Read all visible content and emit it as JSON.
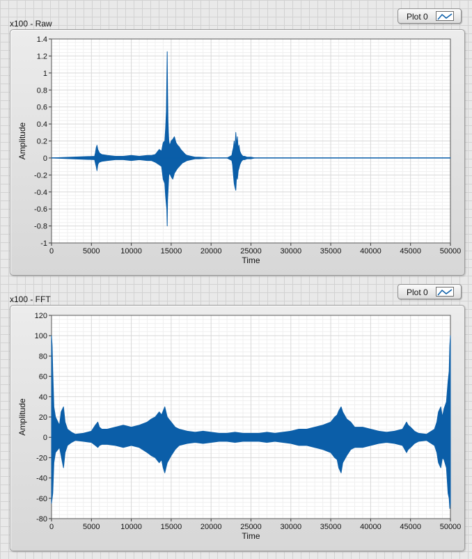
{
  "charts": [
    {
      "title": "x100 - Raw",
      "legend": "Plot 0"
    },
    {
      "title": "x100 - FFT",
      "legend": "Plot 0"
    }
  ],
  "chart_data": [
    {
      "type": "line",
      "title": "x100 - Raw",
      "xlabel": "Time",
      "ylabel": "Amplitude",
      "xlim": [
        0,
        50000
      ],
      "ylim": [
        -1,
        1.4
      ],
      "xticks": [
        0,
        5000,
        10000,
        15000,
        20000,
        25000,
        30000,
        35000,
        40000,
        45000,
        50000
      ],
      "yticks": [
        -1,
        -0.8,
        -0.6,
        -0.4,
        -0.2,
        0,
        0.2,
        0.4,
        0.6,
        0.8,
        1,
        1.2,
        1.4
      ],
      "grid": true,
      "legend_position": "top-right",
      "color": "#0b5ea8",
      "series": [
        {
          "name": "Plot 0",
          "x": [
            0,
            5400,
            5500,
            5600,
            5700,
            5800,
            5900,
            6000,
            6300,
            7000,
            8000,
            9000,
            10000,
            11000,
            12000,
            12500,
            13000,
            13500,
            13800,
            14000,
            14200,
            14300,
            14400,
            14450,
            14500,
            14550,
            14600,
            14650,
            14700,
            14800,
            14900,
            15000,
            15200,
            15400,
            15600,
            15800,
            16000,
            16200,
            16400,
            16600,
            16800,
            17000,
            17500,
            18000,
            18500,
            20000,
            22000,
            22600,
            22700,
            22800,
            22900,
            23000,
            23100,
            23200,
            23300,
            23400,
            23500,
            23600,
            23700,
            23800,
            24000,
            24200,
            24500,
            25000,
            25500,
            26000,
            50000
          ],
          "upper": [
            0,
            0.02,
            0.06,
            0.12,
            0.15,
            0.1,
            0.08,
            0.06,
            0.04,
            0.03,
            0.02,
            0.02,
            0.03,
            0.02,
            0.03,
            0.03,
            0.04,
            0.1,
            0.08,
            0.18,
            0.2,
            0.35,
            0.55,
            0.9,
            1.25,
            0.8,
            0.45,
            0.3,
            0.2,
            0.15,
            0.17,
            0.2,
            0.22,
            0.25,
            0.18,
            0.15,
            0.13,
            0.1,
            0.08,
            0.06,
            0.04,
            0.03,
            0.02,
            0.01,
            0.01,
            0,
            0,
            0.03,
            0.08,
            0.12,
            0.2,
            0.1,
            0.3,
            0.15,
            0.25,
            0.1,
            0.15,
            0.08,
            0.06,
            0.04,
            0.02,
            0.02,
            0.01,
            0.01,
            0,
            0,
            0
          ],
          "lower": [
            0,
            -0.02,
            -0.06,
            -0.1,
            -0.15,
            -0.08,
            -0.06,
            -0.05,
            -0.04,
            -0.03,
            -0.02,
            -0.02,
            -0.03,
            -0.02,
            -0.03,
            -0.03,
            -0.05,
            -0.08,
            -0.1,
            -0.25,
            -0.3,
            -0.45,
            -0.55,
            -0.6,
            -0.8,
            -0.5,
            -0.4,
            -0.3,
            -0.2,
            -0.18,
            -0.2,
            -0.22,
            -0.25,
            -0.18,
            -0.15,
            -0.12,
            -0.1,
            -0.08,
            -0.06,
            -0.05,
            -0.04,
            -0.03,
            -0.02,
            -0.01,
            -0.01,
            0,
            0,
            -0.03,
            -0.08,
            -0.2,
            -0.3,
            -0.35,
            -0.38,
            -0.2,
            -0.25,
            -0.15,
            -0.12,
            -0.08,
            -0.06,
            -0.04,
            -0.02,
            -0.02,
            -0.01,
            -0.01,
            0,
            0,
            0
          ]
        }
      ]
    },
    {
      "type": "line",
      "title": "x100 - FFT",
      "xlabel": "Time",
      "ylabel": "Amplitude",
      "xlim": [
        0,
        50000
      ],
      "ylim": [
        -80,
        120
      ],
      "xticks": [
        0,
        5000,
        10000,
        15000,
        20000,
        25000,
        30000,
        35000,
        40000,
        45000,
        50000
      ],
      "yticks": [
        -80,
        -60,
        -40,
        -20,
        0,
        20,
        40,
        60,
        80,
        100,
        120
      ],
      "grid": true,
      "legend_position": "top-right",
      "color": "#0b5ea8",
      "series": [
        {
          "name": "Plot 0",
          "x": [
            0,
            80,
            160,
            300,
            500,
            800,
            1000,
            1200,
            1500,
            1700,
            2000,
            2500,
            3000,
            4000,
            5000,
            5500,
            5800,
            6000,
            6300,
            7000,
            8000,
            9000,
            10000,
            11000,
            12000,
            12500,
            13000,
            13500,
            13800,
            14000,
            14200,
            14500,
            15000,
            15500,
            16000,
            17000,
            18000,
            19000,
            20000,
            21000,
            22000,
            23000,
            24000,
            25000,
            26000,
            27000,
            28000,
            29000,
            30000,
            31000,
            32000,
            33000,
            34000,
            35000,
            35500,
            35800,
            36000,
            36300,
            36500,
            37000,
            37500,
            38000,
            39000,
            40000,
            41000,
            42000,
            43000,
            44000,
            44500,
            44700,
            45000,
            45500,
            46000,
            47000,
            48000,
            48300,
            48500,
            48800,
            49000,
            49200,
            49500,
            49700,
            49840,
            49920,
            50000
          ],
          "upper": [
            100,
            90,
            65,
            30,
            20,
            15,
            12,
            25,
            30,
            15,
            8,
            5,
            3,
            4,
            6,
            12,
            15,
            10,
            8,
            8,
            10,
            12,
            10,
            12,
            15,
            18,
            20,
            25,
            22,
            26,
            30,
            20,
            15,
            10,
            8,
            6,
            5,
            6,
            5,
            4,
            4,
            5,
            4,
            4,
            4,
            5,
            4,
            5,
            6,
            8,
            8,
            10,
            12,
            15,
            20,
            22,
            26,
            30,
            25,
            18,
            15,
            10,
            10,
            8,
            6,
            5,
            6,
            8,
            15,
            12,
            10,
            6,
            4,
            3,
            8,
            15,
            25,
            30,
            20,
            28,
            35,
            55,
            65,
            90,
            100
          ],
          "lower": [
            -65,
            -60,
            -55,
            -25,
            -15,
            -12,
            -10,
            -18,
            -30,
            -15,
            -8,
            -5,
            -3,
            -4,
            -5,
            -8,
            -10,
            -8,
            -7,
            -7,
            -8,
            -10,
            -8,
            -10,
            -15,
            -18,
            -20,
            -25,
            -22,
            -30,
            -35,
            -25,
            -18,
            -12,
            -8,
            -6,
            -5,
            -6,
            -5,
            -4,
            -4,
            -5,
            -4,
            -4,
            -4,
            -5,
            -4,
            -5,
            -6,
            -8,
            -8,
            -10,
            -12,
            -15,
            -20,
            -22,
            -30,
            -35,
            -25,
            -18,
            -12,
            -10,
            -10,
            -8,
            -6,
            -5,
            -6,
            -8,
            -15,
            -12,
            -10,
            -6,
            -4,
            -3,
            -8,
            -15,
            -25,
            -30,
            -20,
            -22,
            -30,
            -55,
            -60,
            -70,
            -65
          ]
        }
      ]
    }
  ]
}
